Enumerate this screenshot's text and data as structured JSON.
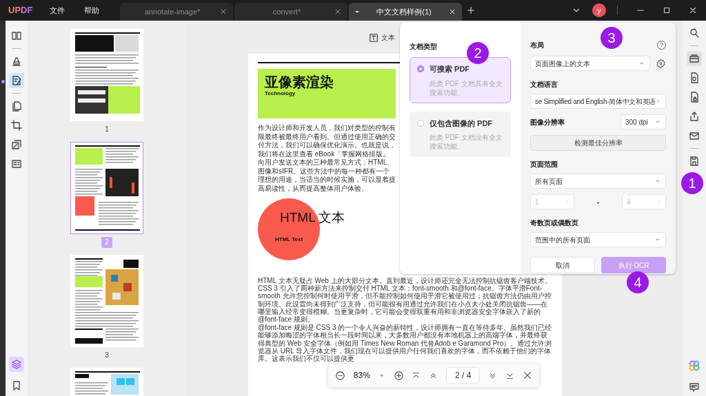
{
  "title_bar": {
    "logo": "UPDF",
    "menus": [
      {
        "label": "文件"
      },
      {
        "label": "帮助"
      }
    ],
    "tabs": [
      {
        "label": "annotate-image*",
        "selected": false
      },
      {
        "label": "convert*",
        "selected": false
      },
      {
        "label": "中文文档样例(1)",
        "selected": true
      }
    ],
    "avatar": "y"
  },
  "left_tools": [
    [
      {
        "kind": "reader",
        "selected": false
      }
    ],
    [
      {
        "kind": "comment",
        "selected": false
      },
      {
        "kind": "edit",
        "selected": true
      }
    ],
    [
      {
        "kind": "pages",
        "selected": false
      },
      {
        "kind": "crop",
        "selected": false
      },
      {
        "kind": "stack",
        "selected": false
      },
      {
        "kind": "form",
        "selected": false
      }
    ]
  ],
  "left_bottom_tools": [
    {
      "kind": "layers",
      "selected": true
    },
    {
      "kind": "bookmark",
      "selected": false
    }
  ],
  "thumbnails": [
    {
      "label": "1",
      "selected": false
    },
    {
      "label": "2",
      "selected": true
    },
    {
      "label": "3",
      "selected": false
    },
    {
      "selected": false
    }
  ],
  "view_label": "文本",
  "document": {
    "heading": "亚像素渲染",
    "subheading": "Technology",
    "intro": "作为设计师和开发人员，我们对类型的控制有限最终被最终用户看到。但通过使用正确的交付方法，我们可以确保优化演示。也就是说，我们将在这里查看 eBook「掌握网格排版」向用户发送文本的三种最常见方式：HTML、图像和sIFR。这些方法中的每一种都有一个理想的用途，当适当的时候实施，可以显着提高易读性，从而提高整体用户体验。",
    "section_title": "HTML 文本",
    "section_subtitle": "HTML Text",
    "paragraphs": [
      "HTML 文本无疑占 Web 上的大部分文本。直到最近，设计师还完全无法控制抗锯齿客户端技术。 CSS 3 引入了两种新方法来控制交付 HTML 文本：font-smooth 和@font-face。字体平滑Font-smooth 允许您控制何时使用平滑，但不能控制如何使用平滑它被使用过；抗锯齿方法仍由用户控制环境。此设置尚未得到广泛支持，但可能很有用通过允许我们在小点大小处关闭抗锯齿——在哪里输入经常变得模糊。当更复杂时，它可能会变得双重有用和非浏览器安全字体嵌入了新的@font-face 规则。",
      "@font-face 规则是 CSS 3 的一个令人兴奋的新特性，设计师拥有一直在等待多年。虽然我们已经能够添加晦涩的字体相当长一段时间以来，大多数用户都没有本地机器上的高端字体，并最终获得典型的 Web 安全字体（例如用 Times New Roman 代替Adob    e Garamond Pro）。通过允许浏览器从 URL 导入字体文件，我们现在可以提供用户任何我们喜欢的字体，而不依赖于他们的字体库。这表示我们不仅可以提供更"
    ]
  },
  "ocr": {
    "doc_type_title": "文档类型",
    "doc_types": [
      {
        "label": "可搜索 PDF",
        "description": "此类 PDF 文档具有全文搜索功能。",
        "selected": true
      },
      {
        "label": "仅包含图像的 PDF",
        "description": "此类 PDF 文档没有全文搜索功能。",
        "selected": false
      }
    ],
    "layout": {
      "label": "布局",
      "value": "页面图像上的文本",
      "help": "?"
    },
    "language": {
      "label": "文档语言",
      "value": "se Simplified and English-简体中文和英语"
    },
    "resolution": {
      "label": "图像分辨率",
      "value": "300 dpi",
      "detect_button": "检测最佳分辨率"
    },
    "page_range": {
      "label": "页面范围",
      "value": "所有页面",
      "from": "1",
      "separator": "-",
      "to": "4",
      "disabled": true
    },
    "odd_even": {
      "label": "奇数页或偶数页",
      "value": "范围中的所有页面"
    },
    "cancel": "取消",
    "run": "执行 OCR"
  },
  "zoom_bar": {
    "zoom": "83%",
    "page": "2 / 4"
  },
  "right_tools": [
    [
      {
        "kind": "search",
        "selected": false
      }
    ],
    [
      {
        "kind": "ocr",
        "selected": true
      },
      {
        "kind": "convert",
        "selected": false
      },
      {
        "kind": "protect",
        "selected": false
      },
      {
        "kind": "share",
        "selected": false
      },
      {
        "kind": "mail",
        "selected": false
      }
    ],
    [
      {
        "kind": "save",
        "selected": false
      }
    ]
  ],
  "right_bottom_tools": [
    {
      "kind": "ai",
      "selected": false
    },
    {
      "kind": "comment",
      "selected": false
    }
  ],
  "step_markers": [
    {
      "label": "1"
    },
    {
      "label": "2"
    },
    {
      "label": "3"
    },
    {
      "label": "4"
    }
  ]
}
